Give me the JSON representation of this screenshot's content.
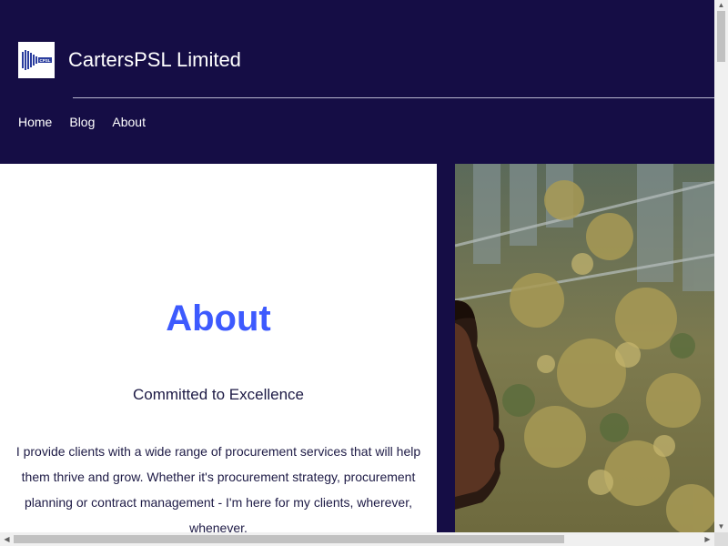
{
  "header": {
    "site_title": "CartersPSL Limited",
    "logo_text": "CPSL"
  },
  "nav": {
    "items": [
      {
        "label": "Home"
      },
      {
        "label": "Blog"
      },
      {
        "label": "About"
      }
    ]
  },
  "main": {
    "heading": "About",
    "subtitle": "Committed to Excellence",
    "body": "I provide clients with a wide range of procurement services that will help them thrive and grow. Whether it's procurement strategy, procurement planning or contract management - I'm here for my clients, wherever, whenever.",
    "photo_icon": "photo-of-woman-outdoors"
  },
  "colors": {
    "header_bg": "#150d45",
    "accent": "#3d5afe",
    "text_dark": "#1d1a45"
  },
  "scrollbars": {
    "up_arrow_icon": "up-arrow-icon",
    "down_arrow_icon": "down-arrow-icon",
    "left_arrow_icon": "left-arrow-icon",
    "right_arrow_icon": "right-arrow-icon"
  }
}
